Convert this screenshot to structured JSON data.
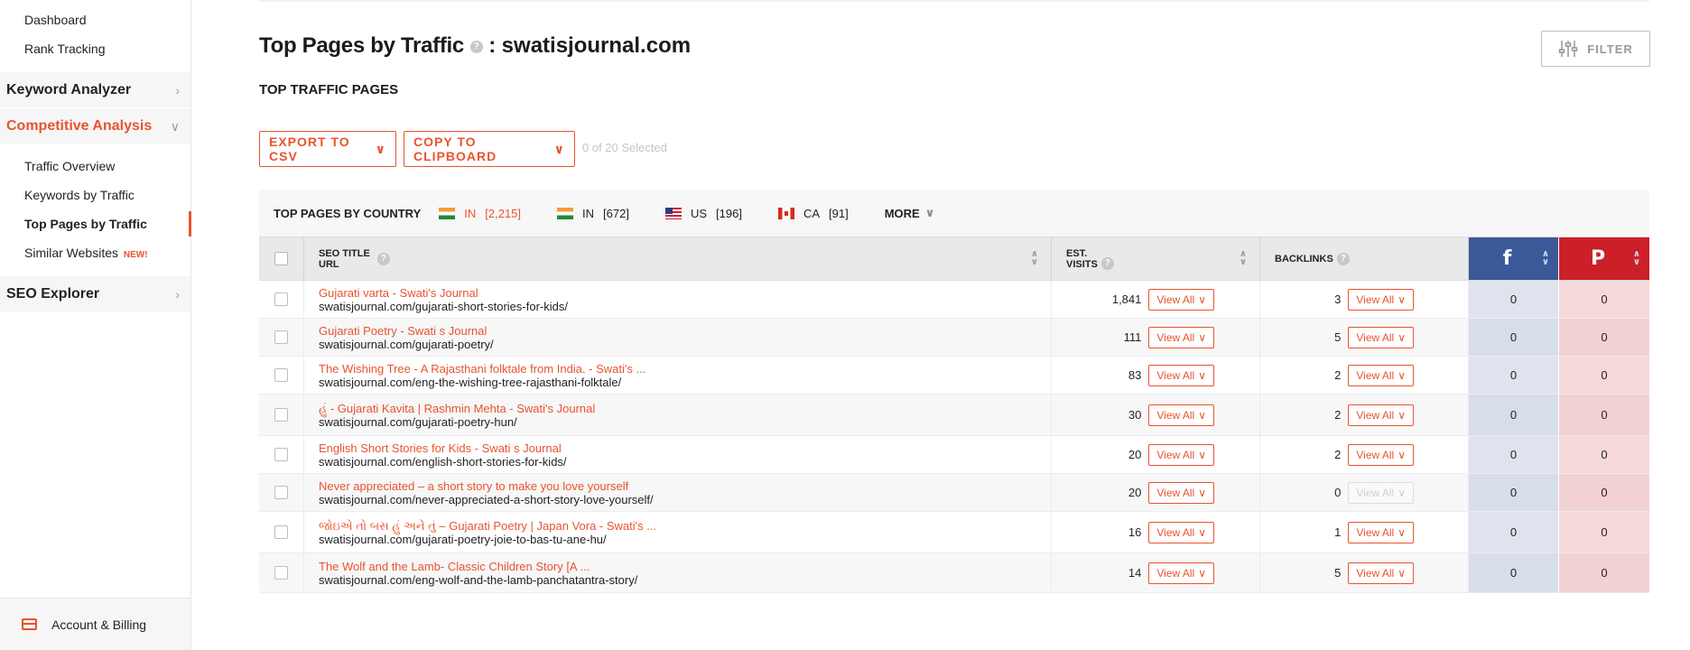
{
  "sidebar": {
    "dashboard": "Dashboard",
    "rank_tracking": "Rank Tracking",
    "keyword_analyzer": "Keyword Analyzer",
    "competitive_analysis": "Competitive Analysis",
    "sub_items": [
      "Traffic Overview",
      "Keywords by Traffic",
      "Top Pages by Traffic",
      "Similar Websites"
    ],
    "new_badge": "NEW!",
    "seo_explorer": "SEO Explorer",
    "account": "Account & Billing"
  },
  "header": {
    "title": "Top Pages by Traffic",
    "separator": ":",
    "domain": "swatisjournal.com",
    "filter_label": "FILTER",
    "section_label": "TOP TRAFFIC PAGES"
  },
  "actions": {
    "export_label": "EXPORT TO CSV",
    "copy_label": "COPY TO CLIPBOARD",
    "selected_text": "0 of 20 Selected"
  },
  "countries": {
    "title": "TOP PAGES BY COUNTRY",
    "items": [
      {
        "code": "IN",
        "count": "[2,215]"
      },
      {
        "code": "IN",
        "count": "[672]"
      },
      {
        "code": "US",
        "count": "[196]"
      },
      {
        "code": "CA",
        "count": "[91]"
      }
    ],
    "more_label": "MORE"
  },
  "table": {
    "headers": {
      "seo_title": "SEO TITLE",
      "url": "URL",
      "est": "EST.",
      "visits": "VISITS",
      "backlinks": "BACKLINKS",
      "facebook_icon": "f",
      "pinterest_icon": "P"
    },
    "view_all": "View All",
    "rows": [
      {
        "title": "Gujarati varta - Swati's Journal",
        "url": "swatisjournal.com/gujarati-short-stories-for-kids/",
        "visits": "1,841",
        "backlinks": "3",
        "fb": "0",
        "pin": "0"
      },
      {
        "title": "Gujarati Poetry - Swati s Journal",
        "url": "swatisjournal.com/gujarati-poetry/",
        "visits": "111",
        "backlinks": "5",
        "fb": "0",
        "pin": "0"
      },
      {
        "title": "The Wishing Tree - A Rajasthani folktale from India. - Swati's ...",
        "url": "swatisjournal.com/eng-the-wishing-tree-rajasthani-folktale/",
        "visits": "83",
        "backlinks": "2",
        "fb": "0",
        "pin": "0"
      },
      {
        "title": "હું - Gujarati Kavita | Rashmin Mehta - Swati's Journal",
        "url": "swatisjournal.com/gujarati-poetry-hun/",
        "visits": "30",
        "backlinks": "2",
        "fb": "0",
        "pin": "0"
      },
      {
        "title": "English Short Stories for Kids - Swati s Journal",
        "url": "swatisjournal.com/english-short-stories-for-kids/",
        "visits": "20",
        "backlinks": "2",
        "fb": "0",
        "pin": "0"
      },
      {
        "title": "Never appreciated – a short story to make you love yourself",
        "url": "swatisjournal.com/never-appreciated-a-short-story-love-yourself/",
        "visits": "20",
        "backlinks": "0",
        "fb": "0",
        "pin": "0"
      },
      {
        "title": "જોઇએ તો બસ હું અને તું – Gujarati Poetry | Japan Vora - Swati's ...",
        "url": "swatisjournal.com/gujarati-poetry-joie-to-bas-tu-ane-hu/",
        "visits": "16",
        "backlinks": "1",
        "fb": "0",
        "pin": "0"
      },
      {
        "title": "The Wolf and the Lamb- Classic Children Story [A ...",
        "url": "swatisjournal.com/eng-wolf-and-the-lamb-panchatantra-story/",
        "visits": "14",
        "backlinks": "5",
        "fb": "0",
        "pin": "0"
      }
    ]
  },
  "colors": {
    "accent": "#e8542f",
    "facebook": "#3b5998",
    "pinterest": "#cb2027"
  }
}
